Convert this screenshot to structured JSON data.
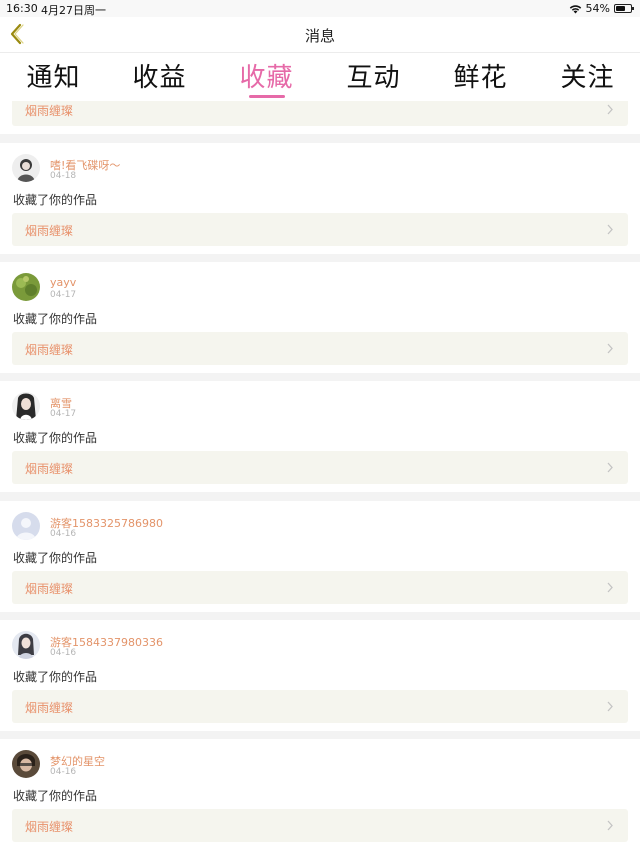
{
  "status_bar": {
    "time": "16:30",
    "date": "4月27日周一",
    "battery": "54%"
  },
  "nav": {
    "title": "消息",
    "back_icon": "chevron-left-icon"
  },
  "tabs": [
    {
      "label": "通知",
      "active": false
    },
    {
      "label": "收益",
      "active": false
    },
    {
      "label": "收藏",
      "active": true
    },
    {
      "label": "互动",
      "active": false
    },
    {
      "label": "鲜花",
      "active": false
    },
    {
      "label": "关注",
      "active": false
    }
  ],
  "colors": {
    "accent": "#e66aa8",
    "username": "#e3946a",
    "work_title": "#e8906a",
    "work_box": "#f5f5ee"
  },
  "partial_item": {
    "work_title": "烟雨缠璨"
  },
  "items": [
    {
      "user": "嗜!看飞碟呀～",
      "date": "04-18",
      "action": "收藏了你的作品",
      "work_title": "烟雨缠璨"
    },
    {
      "user": "yayv",
      "date": "04-17",
      "action": "收藏了你的作品",
      "work_title": "烟雨缠璨"
    },
    {
      "user": "离雪",
      "date": "04-17",
      "action": "收藏了你的作品",
      "work_title": "烟雨缠璨"
    },
    {
      "user": "游客1583325786980",
      "date": "04-16",
      "action": "收藏了你的作品",
      "work_title": "烟雨缠璨"
    },
    {
      "user": "游客1584337980336",
      "date": "04-16",
      "action": "收藏了你的作品",
      "work_title": "烟雨缠璨"
    },
    {
      "user": "梦幻的星空",
      "date": "04-16",
      "action": "收藏了你的作品",
      "work_title": "烟雨缠璨"
    }
  ]
}
